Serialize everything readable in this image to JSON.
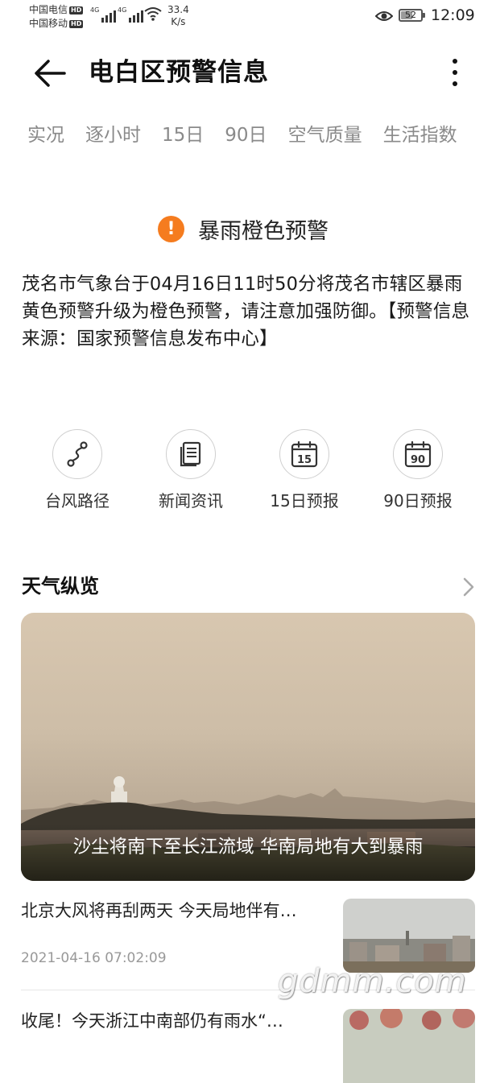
{
  "status_bar": {
    "carrier1": "中国电信",
    "carrier2": "中国移动",
    "hd_badge": "HD",
    "network": "4G",
    "speed_value": "33.4",
    "speed_unit": "K/s",
    "battery": "52",
    "time": "12:09"
  },
  "header": {
    "title": "电白区预警信息"
  },
  "tabs": [
    "实况",
    "逐小时",
    "15日",
    "90日",
    "空气质量",
    "生活指数"
  ],
  "warning": {
    "title": "暴雨橙色预警",
    "body": "茂名市气象台于04月16日11时50分将茂名市辖区暴雨黄色预警升级为橙色预警，请注意加强防御。【预警信息来源：国家预警信息发布中心】"
  },
  "shortcuts": [
    {
      "label": "台风路径",
      "icon": "typhoon-path-icon"
    },
    {
      "label": "新闻资讯",
      "icon": "news-icon"
    },
    {
      "label": "15日预报",
      "icon": "calendar-15-icon",
      "badge": "15"
    },
    {
      "label": "90日预报",
      "icon": "calendar-90-icon",
      "badge": "90"
    }
  ],
  "section": {
    "title": "天气纵览"
  },
  "hero": {
    "caption": "沙尘将南下至长江流域 华南局地有大到暴雨"
  },
  "news": [
    {
      "title": "北京大风将再刮两天 今天局地伴有…",
      "date": "2021-04-16 07:02:09"
    },
    {
      "title": "收尾！今天浙江中南部仍有雨水“…",
      "date": ""
    }
  ],
  "watermark": "gdmm.com",
  "colors": {
    "warning_orange": "#f57c1f",
    "tab_gray": "#8a8a8a"
  }
}
